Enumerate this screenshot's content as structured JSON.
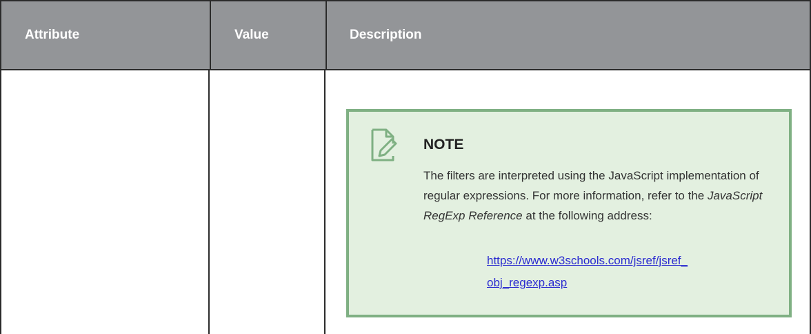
{
  "table": {
    "headers": {
      "attribute": "Attribute",
      "value": "Value",
      "description": "Description"
    }
  },
  "note": {
    "icon": "note-pencil-icon",
    "title": "NOTE",
    "text_before": "The filters are interpreted using the JavaScript implementation of regular expressions. For more information, refer to the ",
    "text_italic": "JavaScript RegExp Reference",
    "text_after": " at the following address:",
    "link_line1": "https://www.w3schools.com/jsref/jsref_",
    "link_line2": "obj_regexp.asp"
  },
  "colors": {
    "header_bg": "#939598",
    "note_bg": "#e3f0e0",
    "note_border": "#7fb083",
    "link": "#2a2ad0"
  }
}
